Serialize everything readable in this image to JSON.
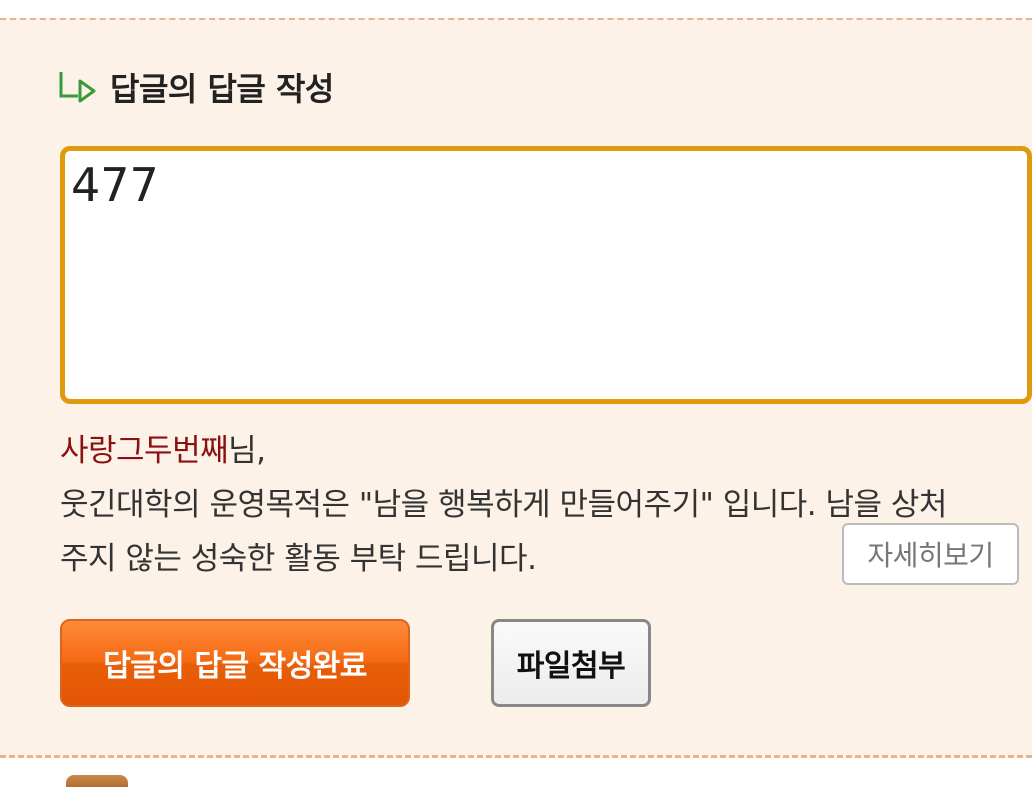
{
  "reply_form": {
    "title": "답글의 답글 작성",
    "textarea_value": "477",
    "notice": {
      "username": "사랑그두번째",
      "honorific": "님,",
      "line1": "웃긴대학의 운영목적은 \"남을 행복하게 만들어주기\" 입니다. 남을 상처",
      "line2": "주지 않는 성숙한 활동 부탁 드립니다."
    },
    "detail_button_label": "자세히보기",
    "submit_button_label": "답글의 답글 작성완료",
    "attach_button_label": "파일첨부"
  },
  "colors": {
    "panel_background": "#fcf2e8",
    "textarea_border": "#e09a10",
    "username": "#8b1010",
    "submit_button": "#f46a12",
    "reply_icon": "#3a9a3a"
  },
  "icons": {
    "reply_icon": "reply-arrow-icon"
  }
}
